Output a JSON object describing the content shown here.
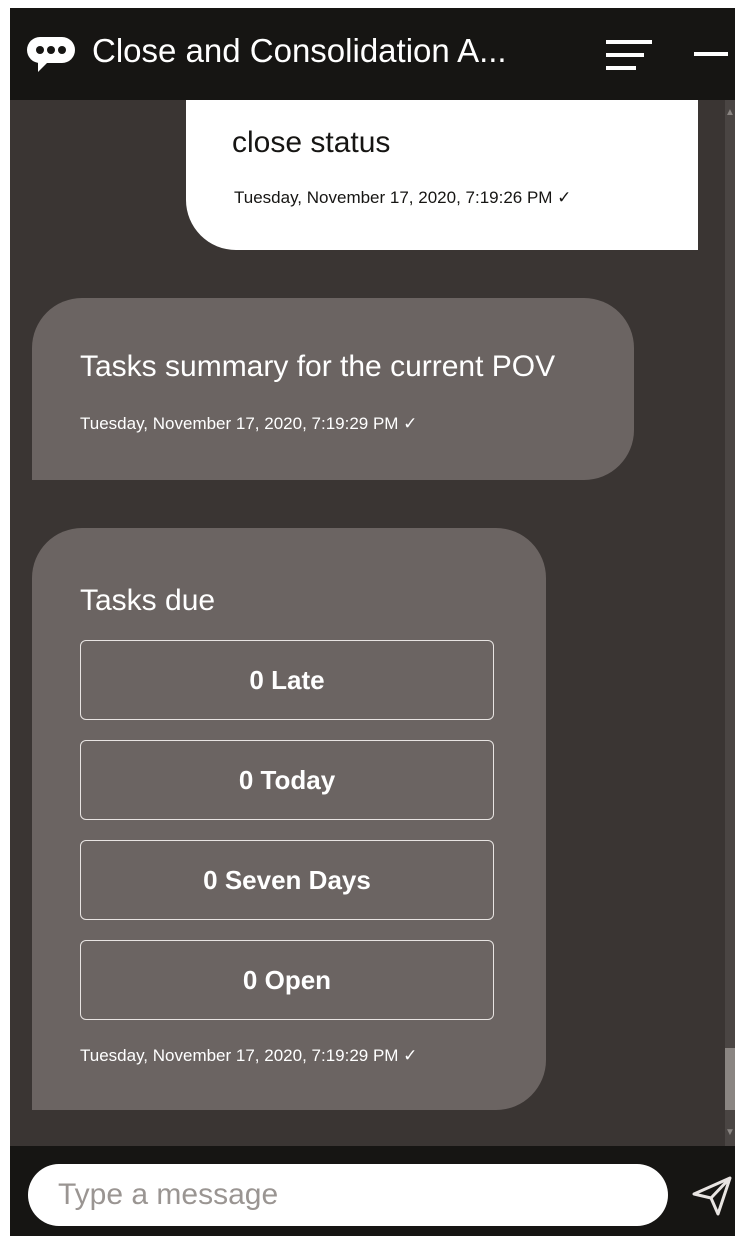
{
  "header": {
    "title": "Close and Consolidation A...",
    "bot_icon": "chat-bubble-icon",
    "menu_icon": "hamburger-menu-icon",
    "minimize_icon": "minimize-icon"
  },
  "messages": {
    "user": {
      "text": "close status",
      "timestamp": "Tuesday, November 17, 2020, 7:19:26 PM ✓"
    },
    "bot_summary": {
      "text": "Tasks summary for the current POV",
      "timestamp": "Tuesday, November 17, 2020, 7:19:29 PM ✓"
    },
    "bot_tasks": {
      "heading": "Tasks due",
      "buttons": [
        "0 Late",
        "0 Today",
        "0 Seven Days",
        "0 Open"
      ],
      "timestamp": "Tuesday, November 17, 2020, 7:19:29 PM ✓"
    }
  },
  "footer": {
    "placeholder": "Type a message",
    "send_icon": "send-icon"
  },
  "colors": {
    "header_bg": "#161513",
    "chat_bg": "#3a3533",
    "bot_bubble": "#6b6462",
    "user_bubble": "#ffffff"
  }
}
